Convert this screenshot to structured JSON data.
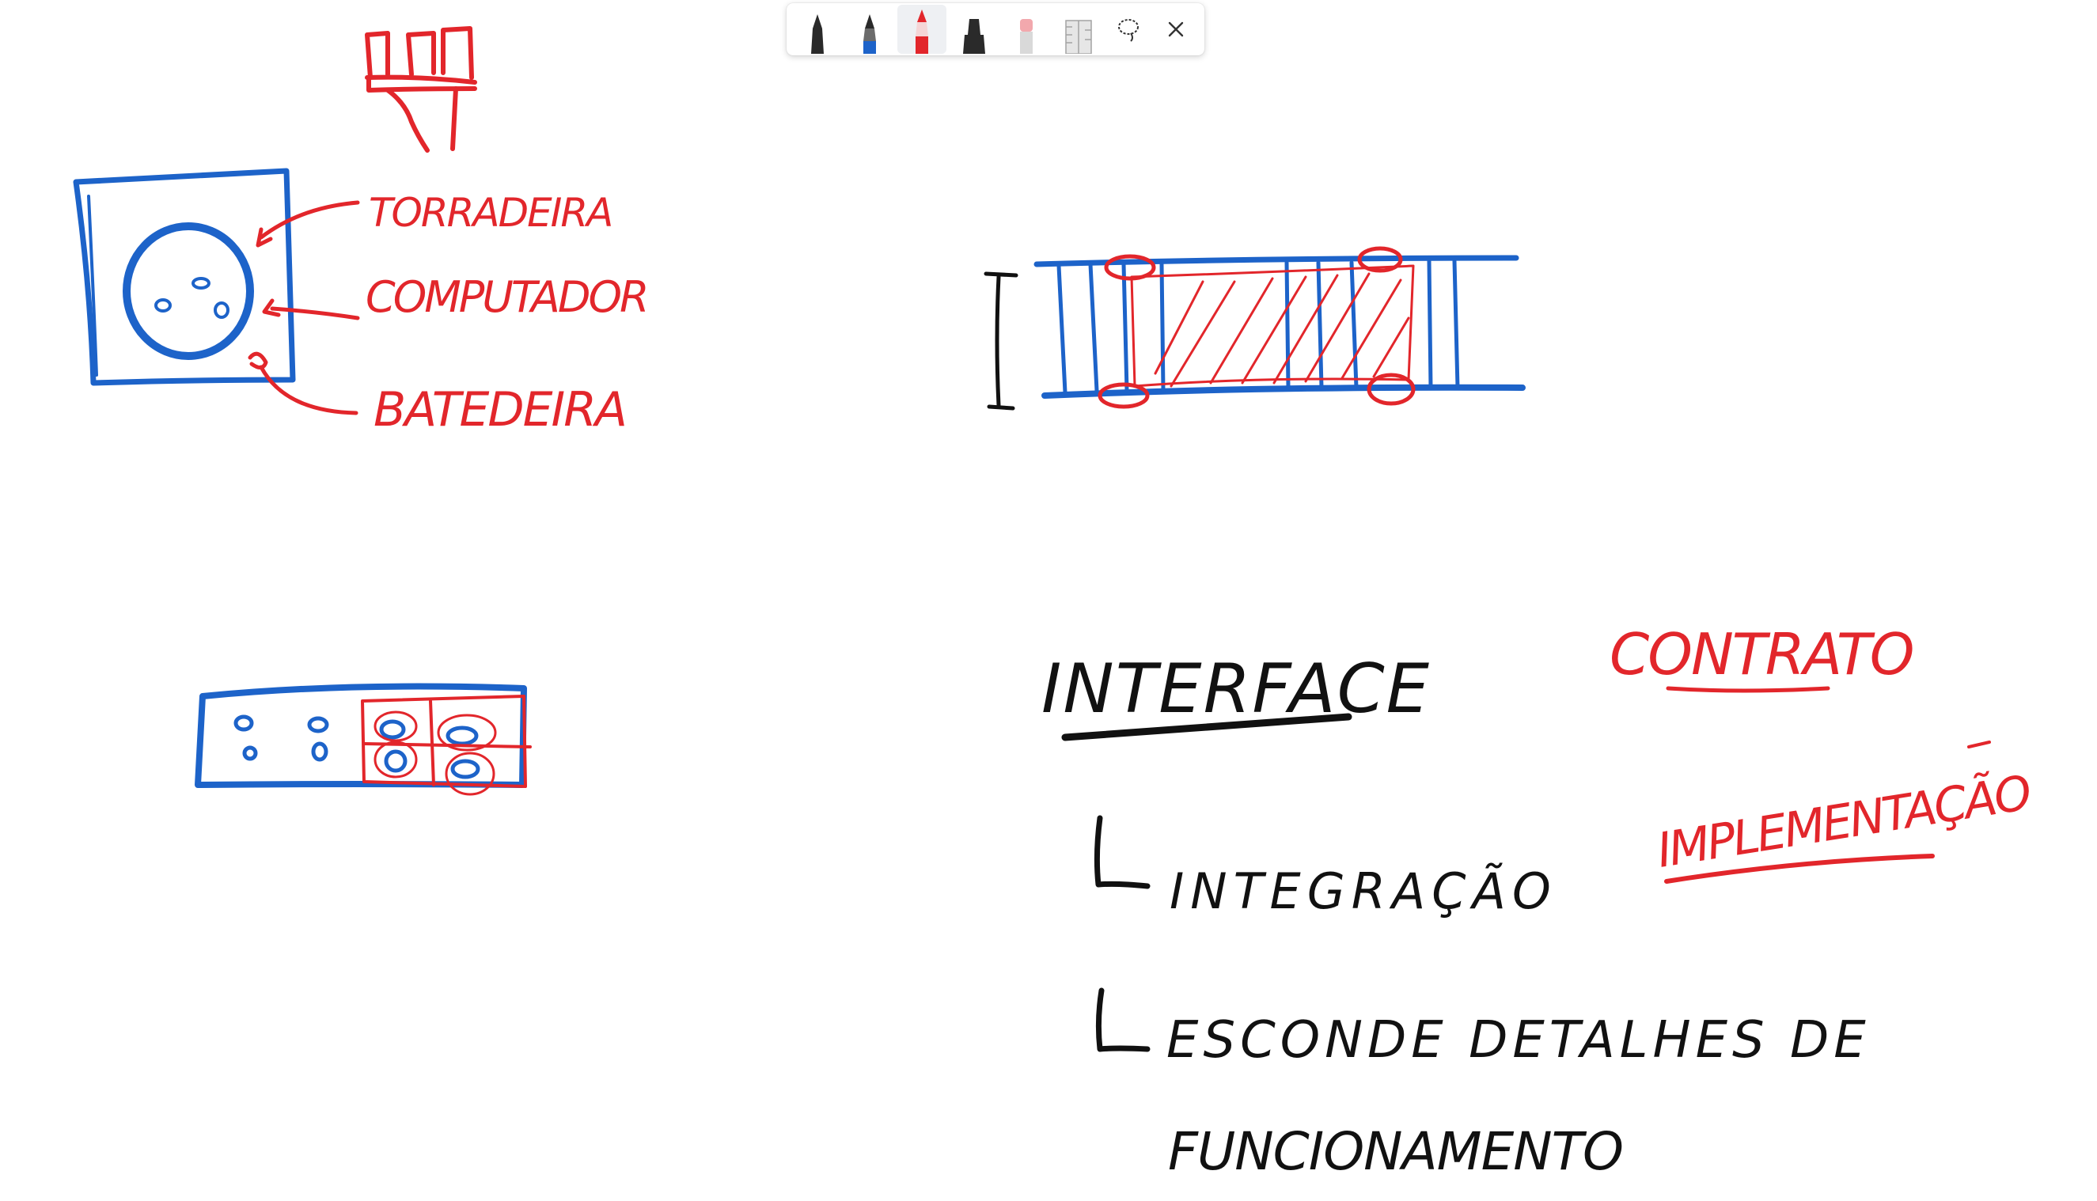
{
  "colors": {
    "blue_ink": "#1d63c9",
    "red_ink": "#e2262b",
    "black_ink": "#111111",
    "background": "#ffffff"
  },
  "toolbar": {
    "tools": [
      {
        "name": "black-pen",
        "icon": "pen-icon",
        "color": "#1a1a1a",
        "selected": false,
        "label": "Black pen"
      },
      {
        "name": "blue-pen",
        "icon": "pen-icon",
        "color": "#1d63c9",
        "selected": false,
        "label": "Blue pen"
      },
      {
        "name": "red-pen",
        "icon": "pen-icon",
        "color": "#e2262b",
        "selected": true,
        "label": "Red pen"
      },
      {
        "name": "highlighter",
        "icon": "highlighter-icon",
        "color": "#1a1a1a",
        "selected": false,
        "label": "Highlighter"
      },
      {
        "name": "eraser",
        "icon": "eraser-icon",
        "color": "#f2a8ad",
        "selected": false,
        "label": "Eraser"
      },
      {
        "name": "ruler",
        "icon": "ruler-icon",
        "color": "#9a9a9a",
        "selected": false,
        "label": "Ruler"
      },
      {
        "name": "lasso",
        "icon": "lasso-icon",
        "color": "#333333",
        "selected": false,
        "label": "Lasso select"
      },
      {
        "name": "close",
        "icon": "close-icon",
        "color": "#333333",
        "selected": false,
        "label": "Close"
      }
    ]
  },
  "handwriting": {
    "torradeira": "TORRADEIRA",
    "computador": "COMPUTADOR",
    "batedeira": "BATEDEIRA",
    "interface": "INTERFACE",
    "contrato": "CONTRATO",
    "implementacao": "IMPLEMENTAÇÃO",
    "integracao": "INTEGRAÇÃO",
    "esconde": "ESCONDE DETALHES DE",
    "funcionamento": "FUNCIONAMENTO"
  }
}
